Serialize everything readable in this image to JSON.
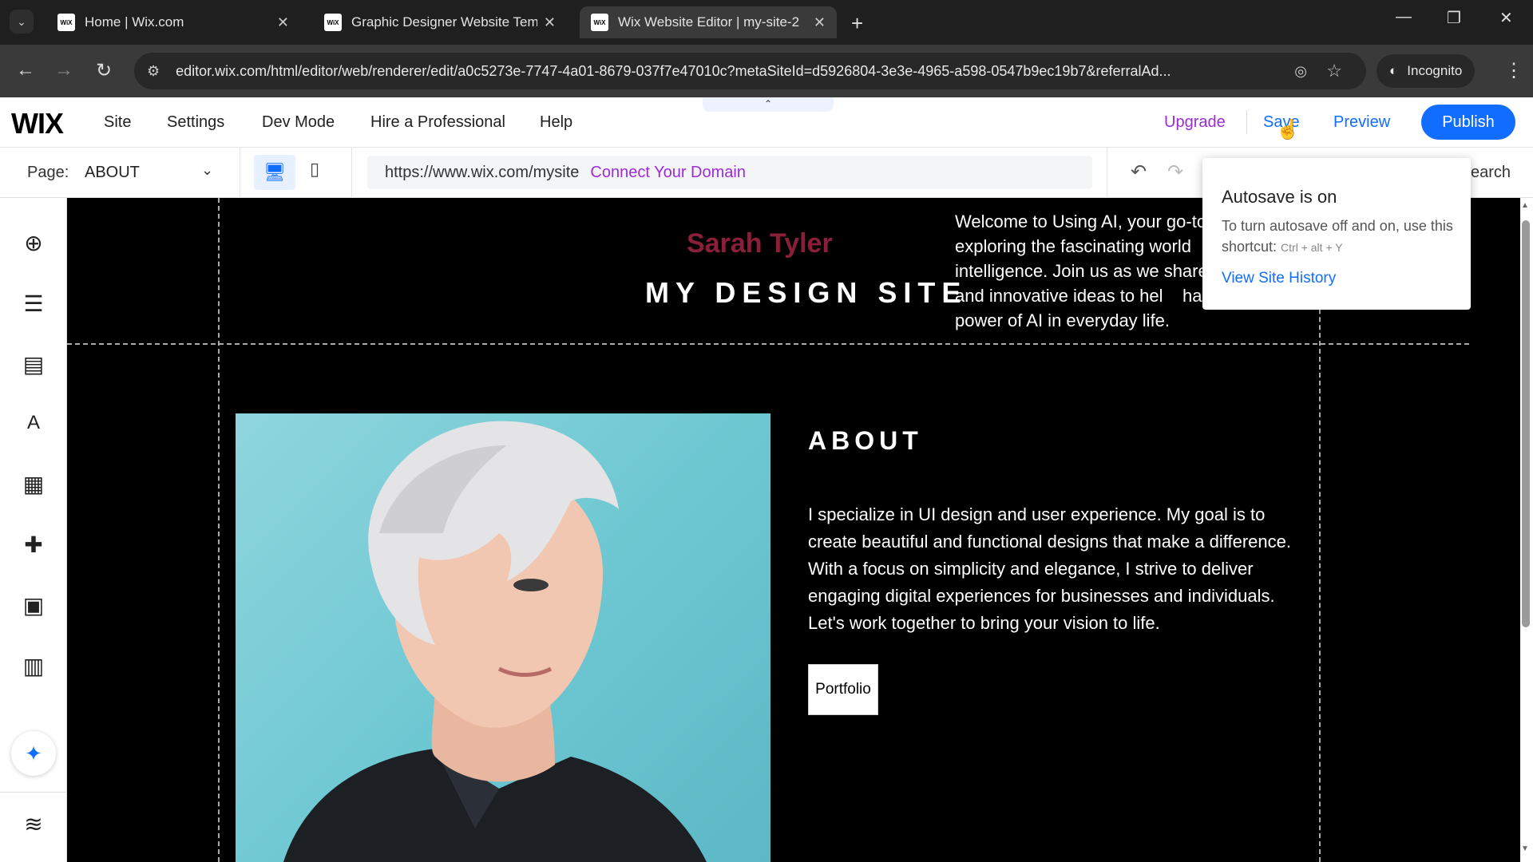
{
  "browser": {
    "tabs": [
      {
        "title": "Home | Wix.com",
        "favicon": "WiX"
      },
      {
        "title": "Graphic Designer Website Temp",
        "favicon": "WiX"
      },
      {
        "title": "Wix Website Editor | my-site-2",
        "favicon": "WiX",
        "active": true
      }
    ],
    "url": "editor.wix.com/html/editor/web/renderer/edit/a0c5273e-7747-4a01-8679-037f7e47010c?metaSiteId=d5926804-3e3e-4965-a598-0547b9ec19b7&referralAd...",
    "incognito_label": "Incognito"
  },
  "editor": {
    "logo": "WIX",
    "menu": [
      "Site",
      "Settings",
      "Dev Mode",
      "Hire a Professional",
      "Help"
    ],
    "upgrade": "Upgrade",
    "save": "Save",
    "preview": "Preview",
    "publish": "Publish",
    "page_label": "Page:",
    "page_value": "ABOUT",
    "site_url": "https://www.wix.com/mysite",
    "connect_domain": "Connect Your Domain",
    "search_partial": "earch"
  },
  "popover": {
    "title": "Autosave is on",
    "desc": "To turn autosave off and on, use this shortcut:",
    "shortcut": "Ctrl + alt + Y",
    "link": "View Site History"
  },
  "site": {
    "name": "Sarah Tyler",
    "title": "MY DESIGN SITE",
    "welcome": "Welcome to Using AI, your go-to    exploring the fascinating world     intelligence. Join us as we share    tips, and innovative ideas to hel    harness the power of AI in everyday life.",
    "about_title": "ABOUT",
    "about_body": "I specialize in UI design and user experience. My goal is to create beautiful and functional designs that make a difference. With a focus on simplicity and elegance, I strive to deliver engaging digital experiences for businesses and individuals. Let's work together to bring your vision to life.",
    "portfolio_button": "Portfolio"
  },
  "colors": {
    "accent_blue": "#116dff",
    "upgrade_purple": "#9d2bd6",
    "site_name_color": "#8a1f3a"
  }
}
